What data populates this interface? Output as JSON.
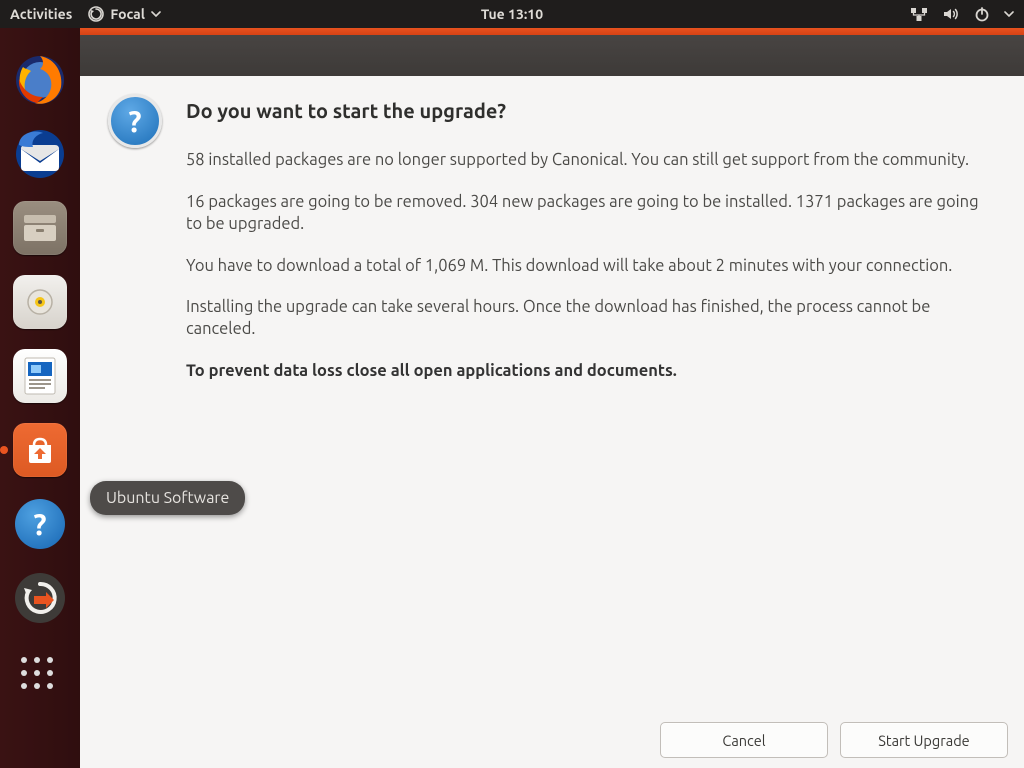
{
  "topbar": {
    "activities": "Activities",
    "app_menu_label": "Focal",
    "clock": "Tue 13:10"
  },
  "dock": {
    "tooltip": "Ubuntu Software"
  },
  "dialog": {
    "heading": "Do you want to start the upgrade?",
    "support_text": "58 installed packages are no longer supported by Canonical. You can still get support from the community.",
    "changes_text": "16 packages are going to be removed. 304 new packages are going to be installed. 1371 packages are going to be upgraded.",
    "download_text": "You have to download a total of 1,069 M. This download will take about 2 minutes with your connection.",
    "install_time_text": "Installing the upgrade can take several hours. Once the download has finished, the process cannot be canceled.",
    "warning_bold": "To prevent data loss close all open applications and documents.",
    "cancel_label": "Cancel",
    "start_label": "Start Upgrade"
  }
}
